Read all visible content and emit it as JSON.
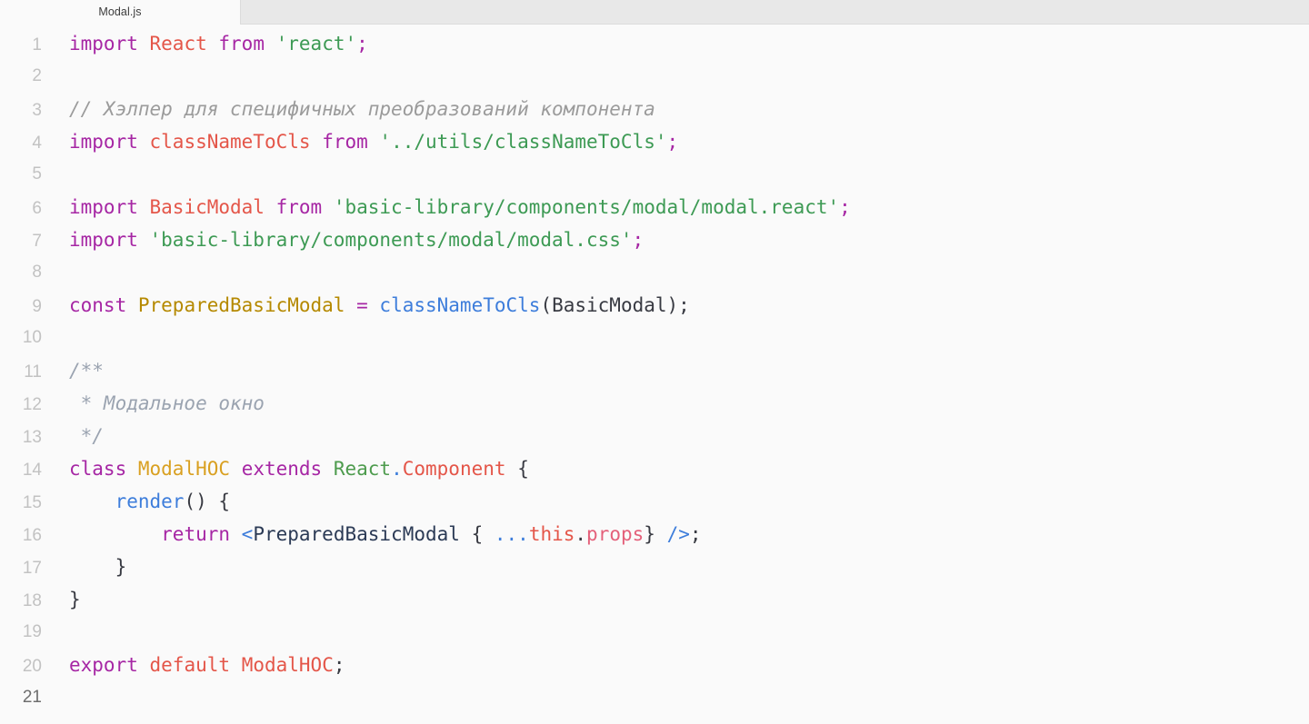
{
  "window": {
    "background_color": "#fafafa"
  },
  "tabbar": {
    "active_tab_label": "Modal.js",
    "empty_area_color": "#e8e8e8"
  },
  "editor": {
    "language": "javascript",
    "current_line": 21,
    "total_lines": 21,
    "colors": {
      "keyword": "#a626a4",
      "identifier": "#e45649",
      "string": "#3d9a54",
      "punctuation": "#383a42",
      "definition": "#b58900",
      "function": "#3d7ddb",
      "comment": "#9b9b9b",
      "docblock": "#9aa3b0",
      "jsx_tag": "#2b3a55",
      "background": "#fafafa",
      "gutter": "#c2c2c2"
    },
    "lines": [
      {
        "n": "1",
        "text": "import React from 'react';"
      },
      {
        "n": "2",
        "text": ""
      },
      {
        "n": "3",
        "text": "// Хэлпер для специфичных преобразований компонента"
      },
      {
        "n": "4",
        "text": "import classNameToCls from '../utils/classNameToCls';"
      },
      {
        "n": "5",
        "text": ""
      },
      {
        "n": "6",
        "text": "import BasicModal from 'basic-library/components/modal/modal.react';"
      },
      {
        "n": "7",
        "text": "import 'basic-library/components/modal/modal.css';"
      },
      {
        "n": "8",
        "text": ""
      },
      {
        "n": "9",
        "text": "const PreparedBasicModal = classNameToCls(BasicModal);"
      },
      {
        "n": "10",
        "text": ""
      },
      {
        "n": "11",
        "text": "/**"
      },
      {
        "n": "12",
        "text": " * Модальное окно"
      },
      {
        "n": "13",
        "text": " */"
      },
      {
        "n": "14",
        "text": "class ModalHOC extends React.Component {"
      },
      {
        "n": "15",
        "text": "    render() {"
      },
      {
        "n": "16",
        "text": "        return <PreparedBasicModal { ...this.props} />;"
      },
      {
        "n": "17",
        "text": "    }"
      },
      {
        "n": "18",
        "text": "}"
      },
      {
        "n": "19",
        "text": ""
      },
      {
        "n": "20",
        "text": "export default ModalHOC;"
      },
      {
        "n": "21",
        "text": ""
      }
    ],
    "tokens": {
      "l1": {
        "kw_import": "import",
        "react": "React",
        "kw_from": "from",
        "str": "'react'",
        "semi": ";"
      },
      "l3": {
        "comment": "// Хэлпер для специфичных преобразований компонента"
      },
      "l4": {
        "kw_import": "import",
        "name": "classNameToCls",
        "kw_from": "from",
        "str": "'../utils/classNameToCls'",
        "semi": ";"
      },
      "l6": {
        "kw_import": "import",
        "name": "BasicModal",
        "kw_from": "from",
        "str": "'basic-library/components/modal/modal.react'",
        "semi": ";"
      },
      "l7": {
        "kw_import": "import",
        "str": "'basic-library/components/modal/modal.css'",
        "semi": ";"
      },
      "l9": {
        "kw_const": "const",
        "def": "PreparedBasicModal",
        "eq": "=",
        "fn": "classNameToCls",
        "args": "(BasicModal);"
      },
      "l11": {
        "doc": "/**"
      },
      "l12": {
        "doc": " * Модальное окно"
      },
      "l13": {
        "doc": " */"
      },
      "l14": {
        "kw_class": "class",
        "cls": "ModalHOC",
        "kw_extends": "extends",
        "react": "React",
        "dot": ".",
        "component": "Component",
        "brace": "{"
      },
      "l15": {
        "fn": "render",
        "rest": "() {"
      },
      "l16": {
        "kw_return": "return",
        "lt": "<",
        "tag": "PreparedBasicModal",
        "obrace": "{",
        "spread": "...",
        "this": "this",
        "dot": ".",
        "props": "props",
        "cbrace": "}",
        "selfclose": "/>",
        "semi": ";"
      },
      "l17": {
        "brace": "}"
      },
      "l18": {
        "brace": "}"
      },
      "l20": {
        "kw_export": "export",
        "kw_default": "default",
        "cls": "ModalHOC",
        "semi": ";"
      }
    }
  }
}
